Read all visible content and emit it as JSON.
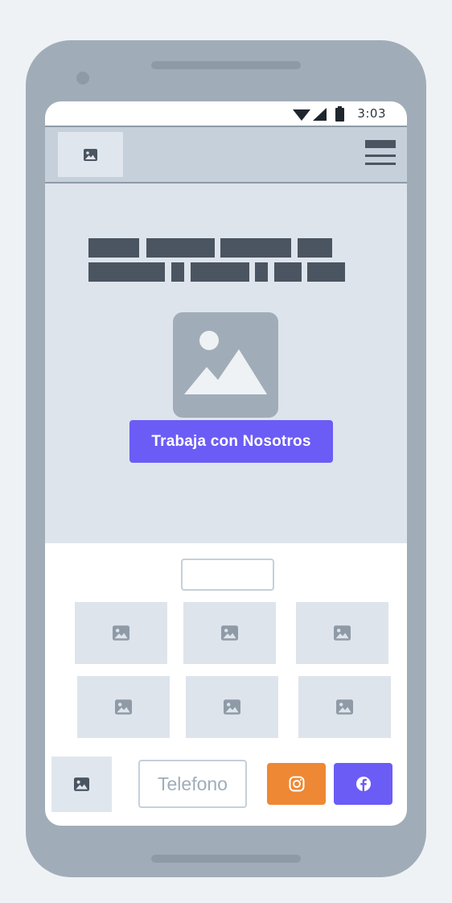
{
  "status_bar": {
    "time": "3:03",
    "icons": [
      "wifi-icon",
      "signal-icon",
      "battery-icon"
    ]
  },
  "header": {
    "logo_icon": "image-placeholder-icon",
    "menu_icon": "hamburger-menu-icon"
  },
  "hero": {
    "image_icon": "image-placeholder-icon",
    "cta_label": "Trabaja con Nosotros"
  },
  "gallery": {
    "tile_icon": "image-placeholder-icon",
    "tiles_count": 6
  },
  "footer": {
    "logo_icon": "image-placeholder-icon",
    "phone_label": "Telefono",
    "instagram_icon": "instagram-icon",
    "facebook_icon": "facebook-icon"
  },
  "colors": {
    "background": "#eff2f5",
    "device": "#a0adb8",
    "accent_purple": "#6b5cf6",
    "accent_orange": "#ee8834",
    "placeholder_dark": "#4a5561",
    "placeholder_light": "#dee4ec"
  }
}
